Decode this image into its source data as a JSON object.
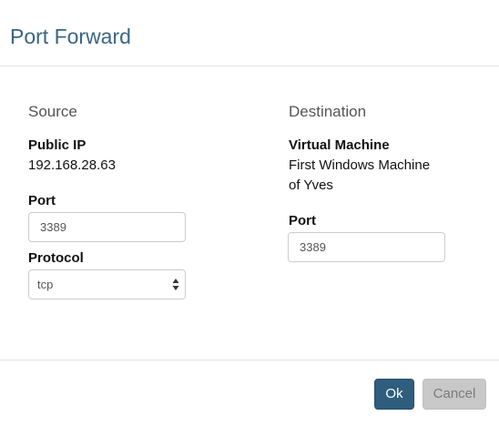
{
  "header": {
    "title": "Port Forward"
  },
  "source": {
    "heading": "Source",
    "public_ip_label": "Public IP",
    "public_ip_value": "192.168.28.63",
    "port_label": "Port",
    "port_value": "3389",
    "protocol_label": "Protocol",
    "protocol_value": "tcp",
    "protocol_icon": "select-updown-arrows-icon"
  },
  "destination": {
    "heading": "Destination",
    "vm_label": "Virtual Machine",
    "vm_value_line1": "First Windows Machine",
    "vm_value_line2": "of Yves",
    "port_label": "Port",
    "port_value": "3389"
  },
  "footer": {
    "ok_label": "Ok",
    "cancel_label": "Cancel"
  },
  "colors": {
    "title": "#3a6584",
    "primary_button": "#2f5d7d",
    "cancel_button": "#c8c8c8"
  }
}
